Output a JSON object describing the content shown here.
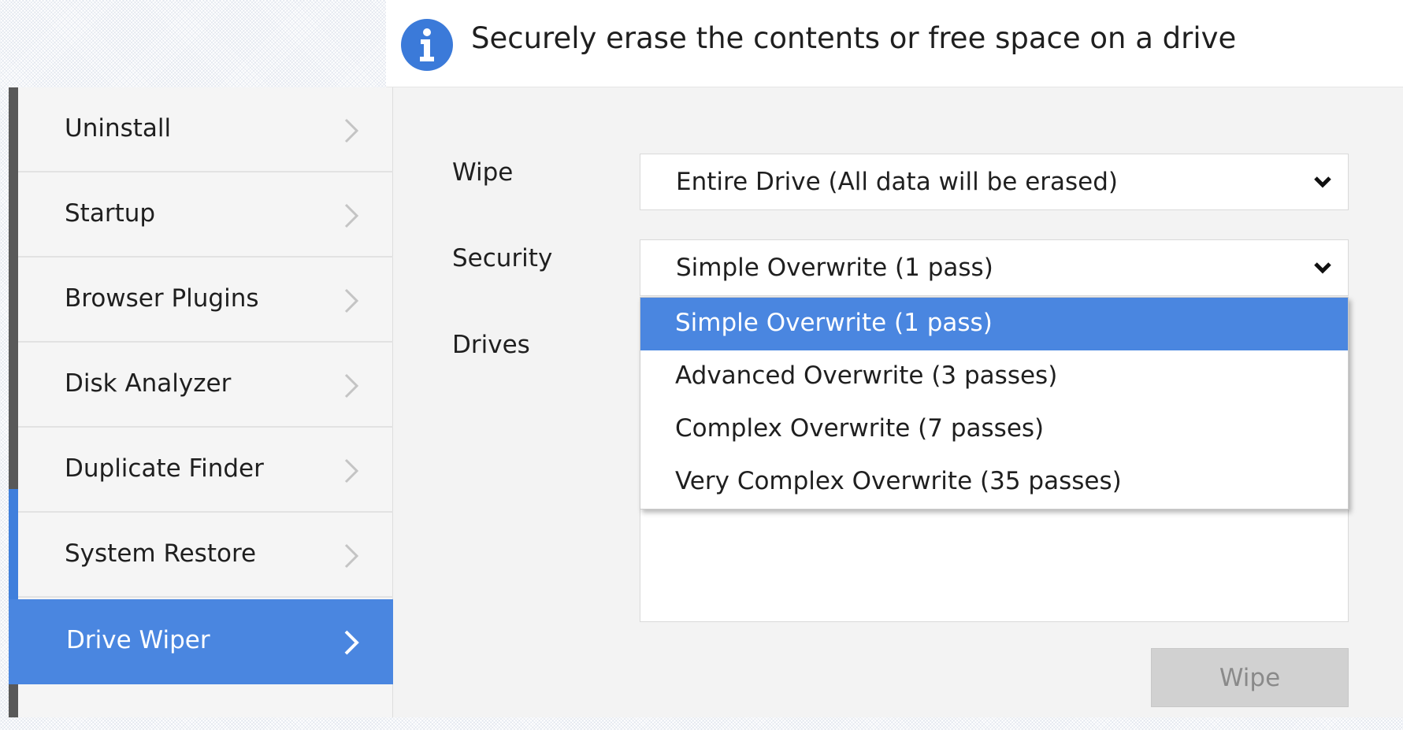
{
  "header": {
    "icon": "info-icon",
    "text": "Securely erase the contents or free space on a drive"
  },
  "colors": {
    "accent": "#4a86e0",
    "sidebar_rail": "#595959",
    "disabled_button": "#d1d1d1"
  },
  "sidebar": {
    "items": [
      {
        "label": "Uninstall",
        "icon": "chevron-right-icon"
      },
      {
        "label": "Startup",
        "icon": "chevron-right-icon"
      },
      {
        "label": "Browser Plugins",
        "icon": "chevron-right-icon"
      },
      {
        "label": "Disk Analyzer",
        "icon": "chevron-right-icon"
      },
      {
        "label": "Duplicate Finder",
        "icon": "chevron-right-icon"
      },
      {
        "label": "System Restore",
        "icon": "chevron-right-icon"
      },
      {
        "label": "Drive Wiper",
        "icon": "chevron-right-icon",
        "active": true
      }
    ]
  },
  "form": {
    "wipe_label": "Wipe",
    "wipe_value": "Entire Drive (All data will be erased)",
    "security_label": "Security",
    "security_value": "Simple Overwrite (1 pass)",
    "drives_label": "Drives"
  },
  "security_dropdown": {
    "open": true,
    "selected_index": 0,
    "options": [
      "Simple Overwrite (1 pass)",
      "Advanced Overwrite (3 passes)",
      "Complex Overwrite (7 passes)",
      "Very Complex Overwrite (35 passes)"
    ]
  },
  "actions": {
    "wipe_button_label": "Wipe",
    "wipe_button_enabled": false
  }
}
